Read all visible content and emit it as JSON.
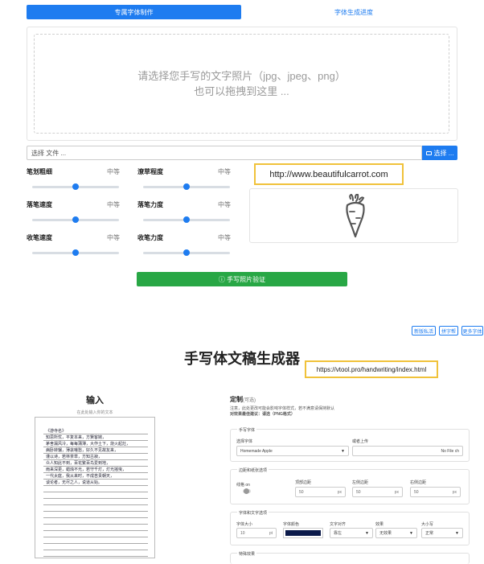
{
  "tabs": {
    "active": "专属字体制作",
    "inactive": "字体生成进度"
  },
  "upload": {
    "line1": "请选择您手写的文字照片（jpg、jpeg、png）",
    "line2": "也可以拖拽到这里 ..."
  },
  "file_input": {
    "placeholder": "选择 文件 ...",
    "browse_label": "选择 ..."
  },
  "sliders": [
    {
      "label": "笔划粗细",
      "value": "中等",
      "level": 0.5
    },
    {
      "label": "潦草程度",
      "value": "中等",
      "level": 0.5
    },
    {
      "label": "落笔速度",
      "value": "中等",
      "level": 0.5
    },
    {
      "label": "落笔力度",
      "value": "中等",
      "level": 0.5
    },
    {
      "label": "收笔速度",
      "value": "中等",
      "level": 0.5
    },
    {
      "label": "收笔力度",
      "value": "中等",
      "level": 0.5
    }
  ],
  "watermark_url_1": "http://www.beautifulcarrot.com",
  "verify_button": "ⓘ 手写照片验证",
  "top_buttons": [
    "新版私活",
    "拼字帮",
    "更多字体"
  ],
  "generator": {
    "title": "手写体文稿生成器",
    "watermark_url_2": "https://vtool.pro/handwriting/index.html",
    "input_title": "输入",
    "input_subtitle": "在此处输入你的文本",
    "paper_lines": [
      "《游寺名》",
      "知思所忧，平复本来，方賢客婉，",
      "茅舍漏风冷，每每蒲薄，大作土下，烧火起灶，",
      "病卧转辗，薄衾嗟愁，好久不见故友来，",
      "谨以诗，若林茶草，方知古寂，",
      "众人知此不到，百花繁百鸟爱到地，",
      "雨来深更，蜡烛不光，若守千灯，灯光摇曳，",
      "一代太庭，我从来时，不成吝贵朝天，",
      "谈论者，无尽之人，说道从始。"
    ],
    "custom_title": "定制",
    "custom_title_suffix": "(可选)",
    "custom_desc_1": "注意，此处更改可能会影响字体样式，若不满意请保持默认",
    "custom_desc_2": "对效果最佳建议：请选（PNG格式）",
    "section_font": {
      "legend": "手写字体",
      "font_label": "选择字体",
      "font_value": "Homemade Apple",
      "upload_label": "或者上传",
      "upload_value": "No File ch"
    },
    "section_margin": {
      "legend": "边距和纸张选项",
      "toggle_label": "线格 on",
      "top_label": "顶部边距",
      "top_value": "50",
      "left_label": "左侧边距",
      "left_value": "50",
      "right_label": "右侧边距",
      "right_value": "50",
      "unit": "px"
    },
    "section_text": {
      "legend": "字体和文字选项",
      "size_label": "字体大小",
      "size_value": "10",
      "size_unit": "pt",
      "color_label": "字体颜色",
      "color_value": "#0b1a4a",
      "align_label": "文字对齐",
      "align_value": "靠左",
      "effect_label": "效果",
      "effect_value": "无效果",
      "case_label": "大小写",
      "case_value": "正常"
    },
    "section_special": {
      "legend": "特殊效果"
    }
  }
}
